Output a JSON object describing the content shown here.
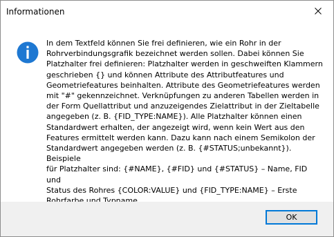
{
  "window": {
    "title": "Informationen"
  },
  "icons": {
    "status": "info-icon",
    "close": "close-icon",
    "info_color": "#1e78d2"
  },
  "message": {
    "text": "In dem Textfeld können Sie frei definieren, wie ein Rohr in der\nRohrverbindungsgrafik bezeichnet werden sollen. Dabei können Sie\nPlatzhalter frei definieren: Platzhalter werden in geschweiften Klammern\ngeschrieben {} und können Attribute des Attributfeatures und\nGeometriefeatures beinhalten. Attribute des Geometriefeatures werden\nmit \"#\" gekennzeichnet. Verknüpfungen zu anderen Tabellen werden in\nder Form Quellattribut und anzuzeigendes Zielattribut in der Zieltabelle\nangegeben (z. B. {FID_TYPE:NAME}). Alle Platzhalter können einen\nStandardwert erhalten, der angezeigt wird, wenn kein Wert aus den\nFeatures ermittelt werden kann. Dazu kann nach einem Semikolon der\nStandardwert angegeben werden (z. B. {#STATUS;unbekannt}). Beispiele\nfür Platzhalter sind: {#NAME}, {#FID} und {#STATUS} – Name, FID und\nStatus des Rohres {COLOR:VALUE} und {FID_TYPE:NAME} – Erste\nRohrfarbe und Typname."
  },
  "footer": {
    "ok_label": "OK"
  }
}
